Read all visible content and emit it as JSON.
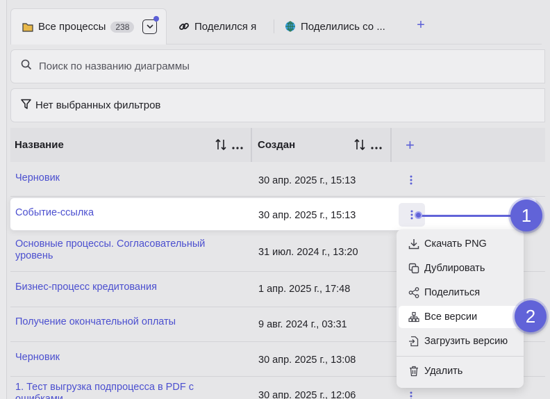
{
  "tabs": [
    {
      "label": "Все процессы",
      "count": "238",
      "icon": "folder-icon"
    },
    {
      "label": "Поделился я",
      "icon": "link-icon"
    },
    {
      "label": "Поделились со ...",
      "icon": "globe-icon"
    }
  ],
  "search": {
    "placeholder": "Поиск по названию диаграммы"
  },
  "filter": {
    "label": "Нет выбранных фильтров"
  },
  "columns": {
    "name": "Название",
    "created": "Создан"
  },
  "rows": [
    {
      "name_line1": "Черновик",
      "name_line2": "",
      "date": "30 апр. 2025 г., 15:13"
    },
    {
      "name_line1": "Событие-ссылка",
      "name_line2": "",
      "date": "30 апр. 2025 г., 15:13"
    },
    {
      "name_line1": "Основные процессы. Согласовательный",
      "name_line2": "уровень",
      "date": "31 июл. 2024 г., 13:20"
    },
    {
      "name_line1": "Бизнес-процесс кредитования",
      "name_line2": "",
      "date": "1 апр. 2025 г., 17:48"
    },
    {
      "name_line1": "Получение окончательной оплаты",
      "name_line2": "",
      "date": "9 авг. 2024 г., 03:31"
    },
    {
      "name_line1": "Черновик",
      "name_line2": "",
      "date": "30 апр. 2025 г., 13:08"
    },
    {
      "name_line1": "1. Тест выгрузка подпроцесса в PDF с",
      "name_line2": "ошибками",
      "date": "30 апр. 2025 г., 12:06"
    }
  ],
  "menu": {
    "download": "Скачать PNG",
    "duplicate": "Дублировать",
    "share": "Поделиться",
    "versions": "Все версии",
    "upload": "Загрузить версию",
    "delete": "Удалить"
  },
  "callouts": {
    "one": "1",
    "two": "2"
  },
  "colors": {
    "accent": "#5b5fd6",
    "link": "#4b4fcf",
    "callout": "#6163d8"
  }
}
